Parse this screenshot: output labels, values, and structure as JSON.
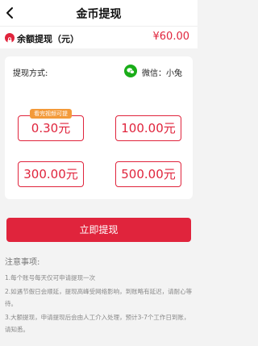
{
  "header": {
    "title": "金币提现"
  },
  "balance": {
    "label": "余额提现（元）",
    "amount": "¥60.00"
  },
  "method": {
    "label": "提现方式:",
    "value": "微信：小兔"
  },
  "options": [
    {
      "amount": "0.30元",
      "badge": "看完视频可提"
    },
    {
      "amount": "100.00元"
    },
    {
      "amount": "300.00元"
    },
    {
      "amount": "500.00元"
    }
  ],
  "submit_label": "立即提现",
  "notes": {
    "title": "注意事项:",
    "items": [
      "1.每个账号每天仅可申请提现一次",
      "2.如遇节假日会顺延，提现高峰受网络影响，到账略有延迟，请耐心等待。",
      "3.大额提现，申请提现后会由人工介入处理，预计3-7个工作日到账，请知悉。"
    ]
  },
  "colors": {
    "accent": "#e0243c",
    "badge": "#f39a3a",
    "wechat": "#1aad19"
  }
}
